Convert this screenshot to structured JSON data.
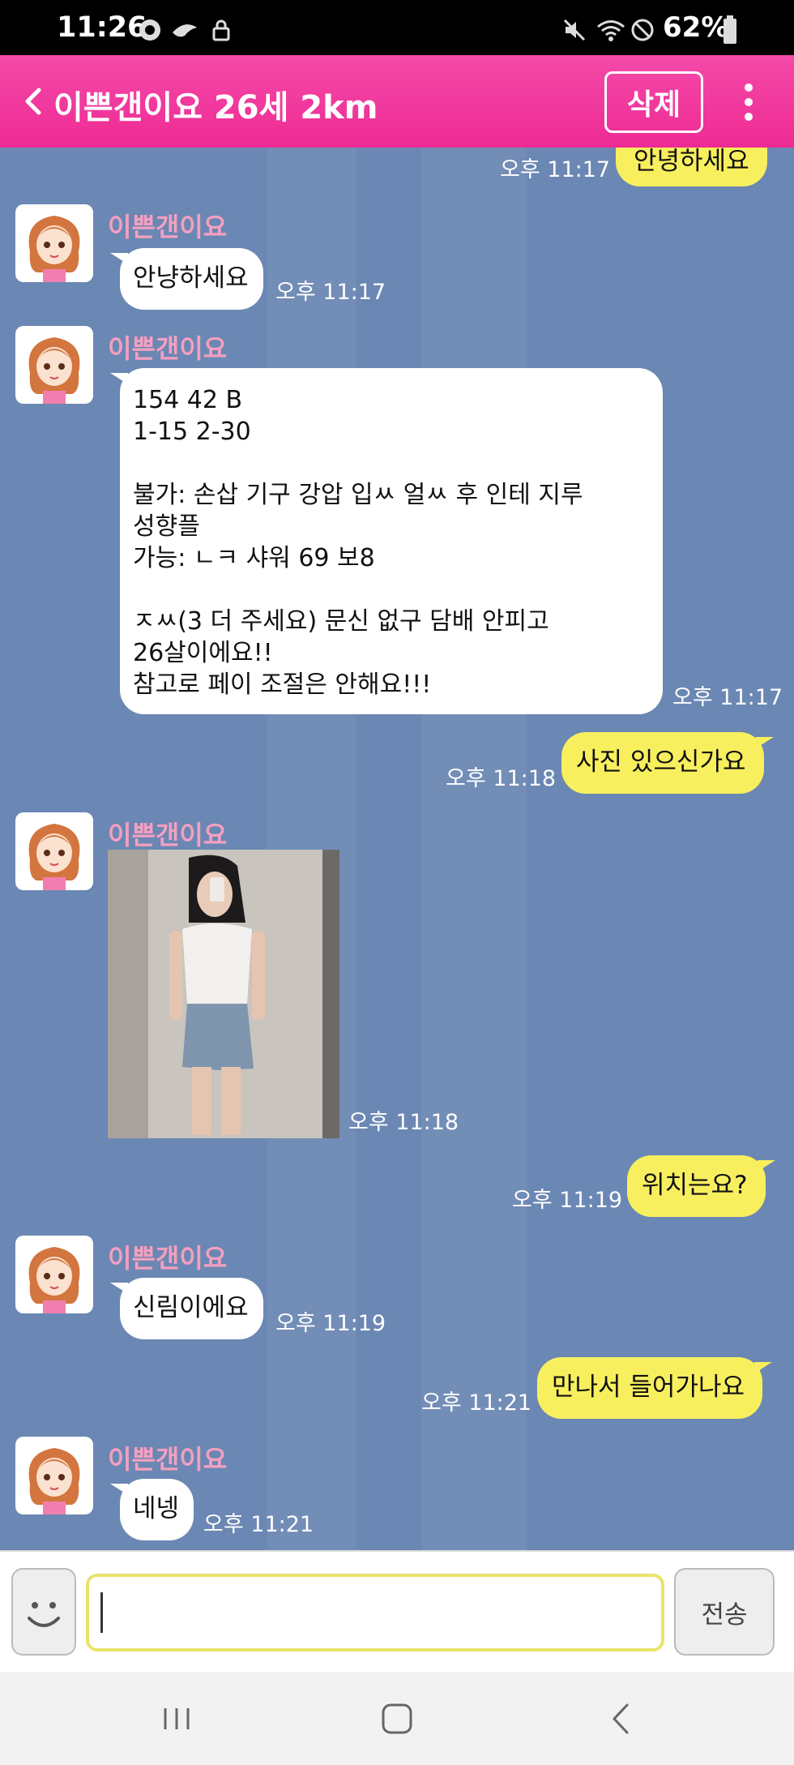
{
  "status_bar": {
    "time": "11:26",
    "battery_percent": "62%",
    "icons": [
      "notification-badge-icon",
      "notification-app-icon",
      "lock-icon",
      "mute-icon",
      "wifi-icon",
      "do-not-disturb-icon",
      "battery-icon"
    ]
  },
  "header": {
    "title": "이쁜갠이요 26세 2km",
    "delete_label": "삭제",
    "back_icon": "chevron-left-icon",
    "more_icon": "more-vertical-icon",
    "color_top": "#f44aa8",
    "color_bottom": "#ee2a94"
  },
  "chat": {
    "background": "#6b87b3",
    "messages": [
      {
        "dir": "out",
        "text": "안녕하세요",
        "time": "오후 11:17"
      },
      {
        "dir": "in",
        "sender": "이쁜갠이요",
        "text": "안냥하세요",
        "time": "오후 11:17"
      },
      {
        "dir": "in",
        "sender": "이쁜갠이요",
        "text": "154 42 B\n1-15 2-30\n\n불가: 손삽 기구 강압 입ㅆ 얼ㅆ 후 인테 지루\n성향플\n가능: ㄴㅋ 샤워 69 보8\n\nㅈㅆ(3 더 주세요) 문신 없구 담배 안피고\n26살이에요!!\n참고로 페이 조절은 안해요!!!",
        "time": "오후 11:17"
      },
      {
        "dir": "out",
        "text": "사진 있으신가요",
        "time": "오후 11:18"
      },
      {
        "dir": "in",
        "sender": "이쁜갠이요",
        "type": "photo",
        "time": "오후 11:18"
      },
      {
        "dir": "out",
        "text": "위치는요?",
        "time": "오후 11:19"
      },
      {
        "dir": "in",
        "sender": "이쁜갠이요",
        "text": "신림이에요",
        "time": "오후 11:19"
      },
      {
        "dir": "out",
        "text": "만나서 들어가나요",
        "time": "오후 11:21"
      },
      {
        "dir": "in",
        "sender": "이쁜갠이요",
        "text": "네넹",
        "time": "오후 11:21"
      }
    ]
  },
  "input_bar": {
    "placeholder": "",
    "value": "",
    "send_label": "전송",
    "emoji_icon": "smiley-icon"
  },
  "nav_bar": {
    "icons": [
      "recent-apps-icon",
      "home-icon",
      "back-icon"
    ]
  }
}
